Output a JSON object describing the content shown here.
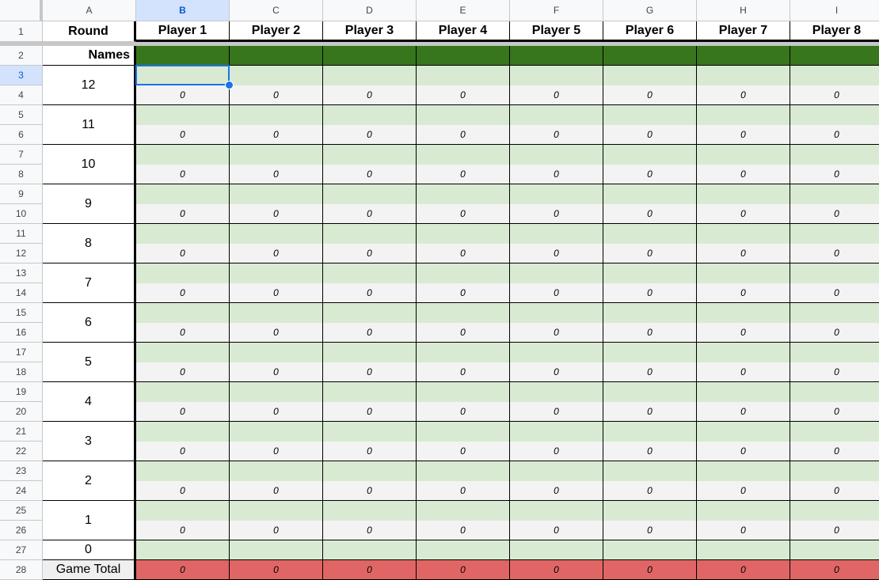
{
  "columns": [
    "A",
    "B",
    "C",
    "D",
    "E",
    "F",
    "G",
    "H",
    "I"
  ],
  "selected_cell": "B3",
  "header_row": {
    "round_label": "Round",
    "players": [
      "Player 1",
      "Player 2",
      "Player 3",
      "Player 4",
      "Player 5",
      "Player 6",
      "Player 7",
      "Player 8"
    ]
  },
  "names_row": {
    "label": "Names",
    "values": [
      "",
      "",
      "",
      "",
      "",
      "",
      "",
      ""
    ]
  },
  "rounds": [
    {
      "round": "12",
      "scores": [
        "0",
        "0",
        "0",
        "0",
        "0",
        "0",
        "0",
        "0"
      ]
    },
    {
      "round": "11",
      "scores": [
        "0",
        "0",
        "0",
        "0",
        "0",
        "0",
        "0",
        "0"
      ]
    },
    {
      "round": "10",
      "scores": [
        "0",
        "0",
        "0",
        "0",
        "0",
        "0",
        "0",
        "0"
      ]
    },
    {
      "round": "9",
      "scores": [
        "0",
        "0",
        "0",
        "0",
        "0",
        "0",
        "0",
        "0"
      ]
    },
    {
      "round": "8",
      "scores": [
        "0",
        "0",
        "0",
        "0",
        "0",
        "0",
        "0",
        "0"
      ]
    },
    {
      "round": "7",
      "scores": [
        "0",
        "0",
        "0",
        "0",
        "0",
        "0",
        "0",
        "0"
      ]
    },
    {
      "round": "6",
      "scores": [
        "0",
        "0",
        "0",
        "0",
        "0",
        "0",
        "0",
        "0"
      ]
    },
    {
      "round": "5",
      "scores": [
        "0",
        "0",
        "0",
        "0",
        "0",
        "0",
        "0",
        "0"
      ]
    },
    {
      "round": "4",
      "scores": [
        "0",
        "0",
        "0",
        "0",
        "0",
        "0",
        "0",
        "0"
      ]
    },
    {
      "round": "3",
      "scores": [
        "0",
        "0",
        "0",
        "0",
        "0",
        "0",
        "0",
        "0"
      ]
    },
    {
      "round": "2",
      "scores": [
        "0",
        "0",
        "0",
        "0",
        "0",
        "0",
        "0",
        "0"
      ]
    },
    {
      "round": "1",
      "scores": [
        "0",
        "0",
        "0",
        "0",
        "0",
        "0",
        "0",
        "0"
      ]
    }
  ],
  "round_zero": {
    "round": "0"
  },
  "game_total": {
    "label": "Game Total",
    "values": [
      "0",
      "0",
      "0",
      "0",
      "0",
      "0",
      "0",
      "0"
    ]
  },
  "colors": {
    "names_fill": "#38761d",
    "entry_fill": "#d9ead3",
    "score_fill": "#f3f3f3",
    "total_fill": "#e06666",
    "total_label_fill": "#efefef",
    "selection": "#1a73e8"
  }
}
